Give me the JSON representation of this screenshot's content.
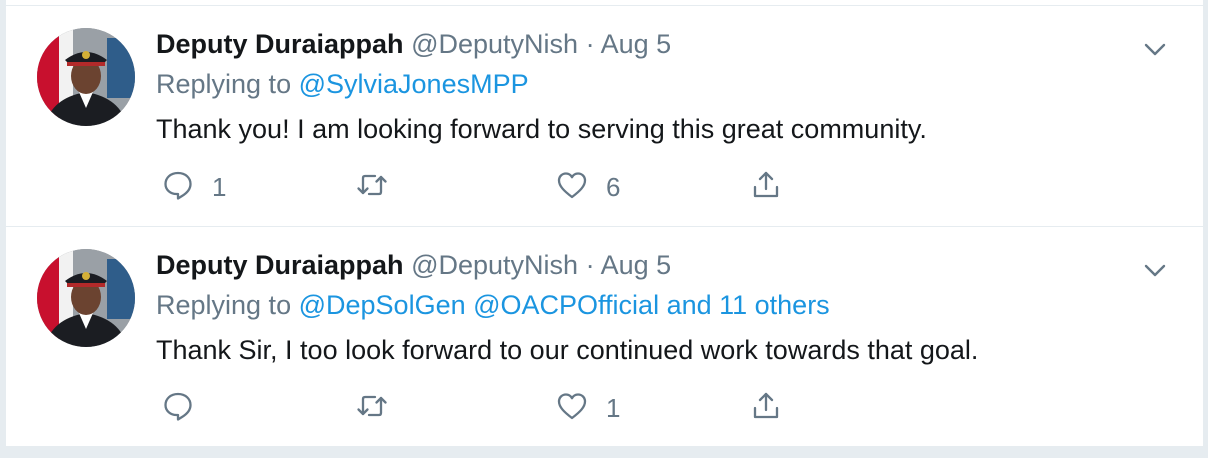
{
  "tweets": [
    {
      "display_name": "Deputy Duraiappah",
      "handle": "@DeputyNish",
      "separator": "·",
      "date": "Aug 5",
      "replying_prefix": "Replying to",
      "replying_to": "@SylviaJonesMPP",
      "text": "Thank you!  I am looking forward to serving this great community.",
      "reply_count": "1",
      "retweet_count": "",
      "like_count": "6"
    },
    {
      "display_name": "Deputy Duraiappah",
      "handle": "@DeputyNish",
      "separator": "·",
      "date": "Aug 5",
      "replying_prefix": "Replying to",
      "replying_to": "@DepSolGen @OACPOfficial and 11 others",
      "text": "Thank Sir, I too look forward to our continued work towards that goal.",
      "reply_count": "",
      "retweet_count": "",
      "like_count": "1"
    }
  ],
  "icons": {
    "reply": "reply-icon",
    "retweet": "retweet-icon",
    "like": "heart-icon",
    "share": "share-icon",
    "more": "chevron-down-icon"
  },
  "colors": {
    "name": "#14171a",
    "muted": "#657786",
    "link": "#1b95e0",
    "border": "#e6ecf0",
    "background": "#e6ecf0"
  }
}
